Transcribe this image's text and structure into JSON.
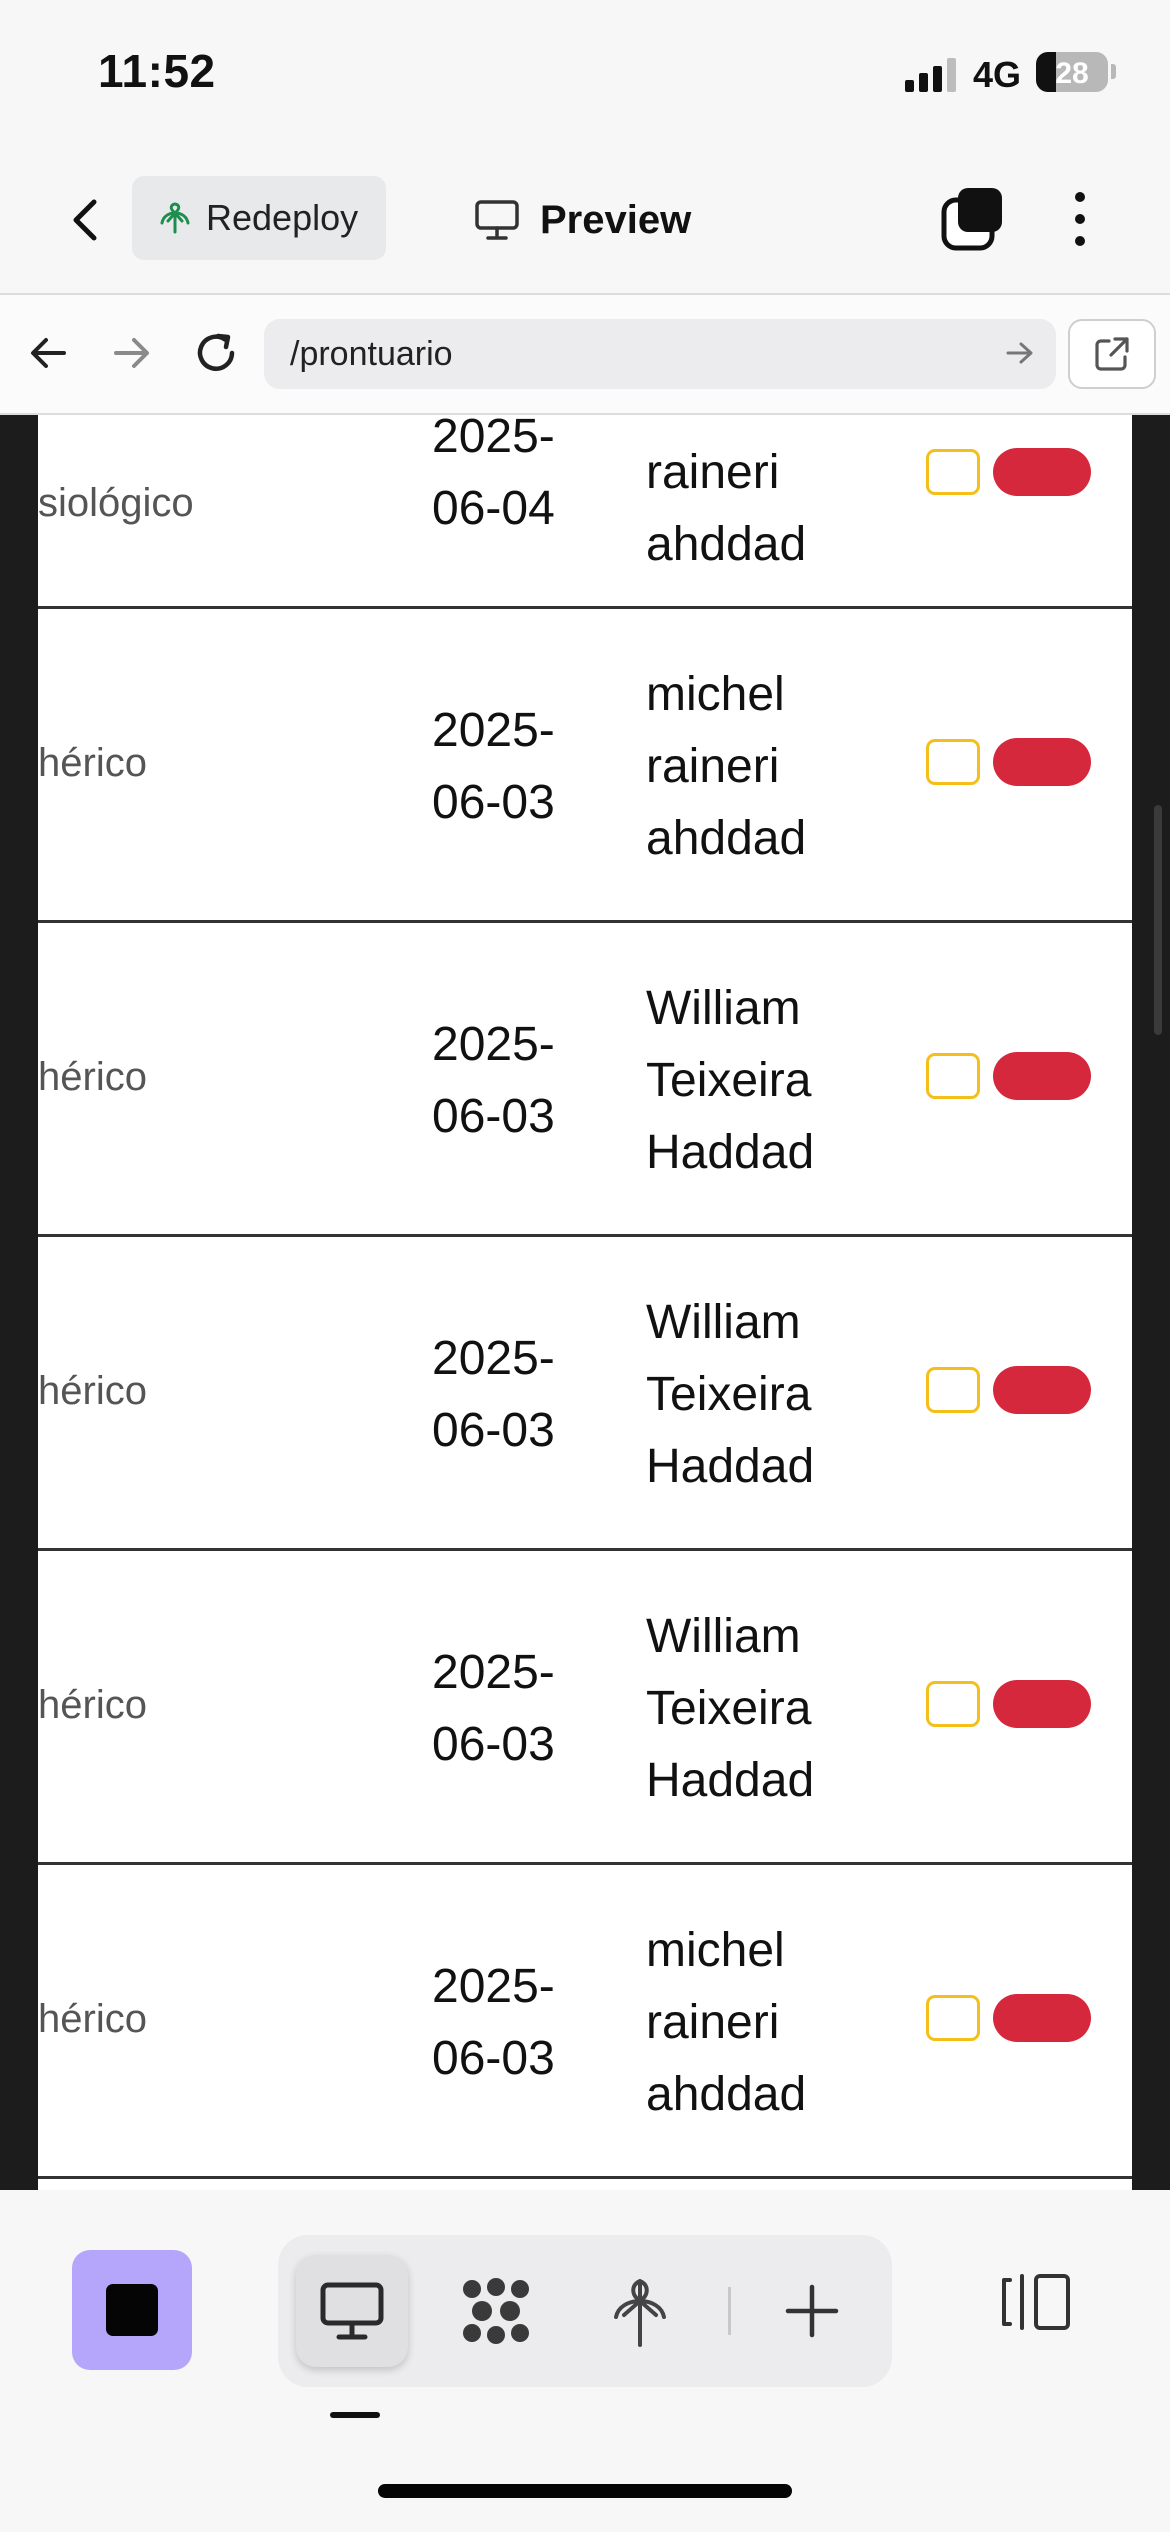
{
  "status_bar": {
    "time": "11:52",
    "network": "4G",
    "battery": "28",
    "signal_bars_filled": 3,
    "signal_bars_total": 4
  },
  "header": {
    "back_icon": "chevron-left-icon",
    "redeploy_label": "Redeploy",
    "redeploy_icon": "deploy-tree-icon",
    "redeploy_icon_color": "#1e8e4e",
    "preview_label": "Preview",
    "preview_icon": "monitor-icon",
    "tabs_icon": "tabs-stack-icon",
    "more_icon": "more-vertical-icon"
  },
  "url_bar": {
    "path": "/prontuario",
    "back_icon": "arrow-left-icon",
    "forward_icon": "arrow-right-icon",
    "reload_icon": "reload-icon",
    "go_icon": "arrow-right-icon",
    "external_icon": "external-link-icon"
  },
  "table": {
    "rows": [
      {
        "type": "siológico",
        "date_year": "2025-",
        "date_md": "06-04",
        "user_lines": [
          "raineri",
          "ahddad"
        ],
        "date_year_clipped": true
      },
      {
        "type": "hérico",
        "date_year": "2025-",
        "date_md": "06-03",
        "user_lines": [
          "michel",
          "raineri",
          "ahddad"
        ]
      },
      {
        "type": "hérico",
        "date_year": "2025-",
        "date_md": "06-03",
        "user_lines": [
          "William",
          "Teixeira",
          "Haddad"
        ]
      },
      {
        "type": "hérico",
        "date_year": "2025-",
        "date_md": "06-03",
        "user_lines": [
          "William",
          "Teixeira",
          "Haddad"
        ]
      },
      {
        "type": "hérico",
        "date_year": "2025-",
        "date_md": "06-03",
        "user_lines": [
          "William",
          "Teixeira",
          "Haddad"
        ]
      },
      {
        "type": "hérico",
        "date_year": "2025-",
        "date_md": "06-03",
        "user_lines": [
          "michel",
          "raineri",
          "ahddad"
        ]
      }
    ],
    "edit_button_color": "#f5bf1a",
    "delete_button_color": "#d6283d"
  },
  "toolbar": {
    "stop_icon": "stop-icon",
    "stop_button_color": "#b6a6fb",
    "tools": [
      {
        "name": "preview-tool",
        "icon": "monitor-icon",
        "active": true
      },
      {
        "name": "workflows-tool",
        "icon": "dots-cluster-icon",
        "active": false
      },
      {
        "name": "deploy-tool",
        "icon": "deploy-tree-icon",
        "active": false
      },
      {
        "name": "add-tool",
        "icon": "plus-icon",
        "active": false
      }
    ],
    "panel_icon": "split-panel-icon"
  }
}
